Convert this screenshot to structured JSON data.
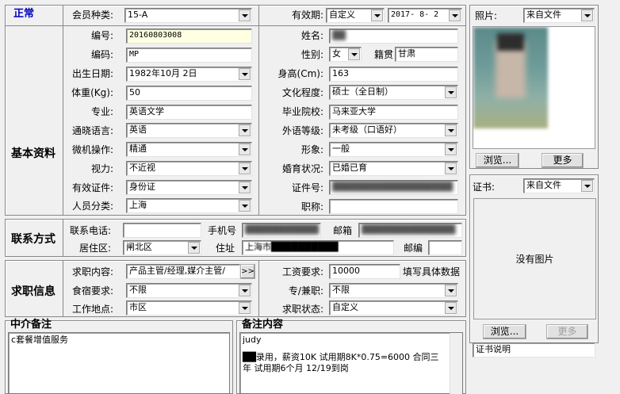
{
  "section_status": "正常",
  "membership": {
    "label": "会员种类:",
    "value": "15-A"
  },
  "validity": {
    "label": "有效期:",
    "mode": "自定义",
    "date": "2017- 8- 2"
  },
  "photo": {
    "label": "照片:",
    "source": "来自文件",
    "browse": "浏览...",
    "more": "更多"
  },
  "basic": {
    "section": "基本资料",
    "id_label": "编号:",
    "id_value": "20160803008",
    "name_label": "姓名:",
    "name_value": "██",
    "code_label": "编码:",
    "code_value": "MP",
    "gender_label": "性别:",
    "gender_value": "女",
    "origin_label": "籍贯",
    "origin_value": "甘肃",
    "birth_label": "出生日期:",
    "birth_value": "1982年10月 2日",
    "height_label": "身高(Cm):",
    "height_value": "163",
    "weight_label": "体重(Kg):",
    "weight_value": "50",
    "edu_label": "文化程度:",
    "edu_value": "硕士（全日制）",
    "major_label": "专业:",
    "major_value": "英语文学",
    "school_label": "毕业院校:",
    "school_value": "马来亚大学",
    "lang_label": "通晓语言:",
    "lang_value": "英语",
    "lang_level_label": "外语等级:",
    "lang_level_value": "未考级（口语好）",
    "computer_label": "微机操作:",
    "computer_value": "精通",
    "image_label": "形象:",
    "image_value": "一般",
    "vision_label": "视力:",
    "vision_value": "不近视",
    "marital_label": "婚育状况:",
    "marital_value": "已婚已育",
    "cert_label": "有效证件:",
    "cert_value": "身份证",
    "cert_no_label": "证件号:",
    "cert_no_value": "██████████████████",
    "category_label": "人员分类:",
    "category_value": "上海",
    "title_label": "职称:",
    "title_value": ""
  },
  "contact": {
    "section": "联系方式",
    "phone_label": "联系电话:",
    "phone_value": "",
    "mobile_label": "手机号",
    "mobile_value": "███████████",
    "email_label": "邮箱",
    "email_value": "██████████████",
    "district_label": "居住区:",
    "district_value": "闸北区",
    "address_label": "住址",
    "address_value": "上海市██████████",
    "zip_label": "邮编",
    "zip_value": ""
  },
  "job": {
    "section": "求职信息",
    "content_label": "求职内容:",
    "content_value": "产品主管/经理,媒介主管/",
    "more_btn": ">>",
    "salary_label": "工资要求:",
    "salary_value": "10000",
    "salary_hint": "填写具体数据",
    "board_label": "食宿要求:",
    "board_value": "不限",
    "parttime_label": "专/兼职:",
    "parttime_value": "不限",
    "location_label": "工作地点:",
    "location_value": "市区",
    "status_label": "求职状态:",
    "status_value": "自定义"
  },
  "agency_note": {
    "label": "中介备注",
    "text": "c套餐增值服务"
  },
  "remarks": {
    "label": "备注内容",
    "line1": "judy",
    "line2": "██录用，薪资10K 试用期8K*0.75=6000 合同三",
    "line3": "年 试用期6个月 12/19到岗"
  },
  "certificate": {
    "label": "证书:",
    "source": "来自文件",
    "no_image": "没有图片",
    "browse": "浏览...",
    "more": "更多",
    "desc": "证书说明"
  }
}
